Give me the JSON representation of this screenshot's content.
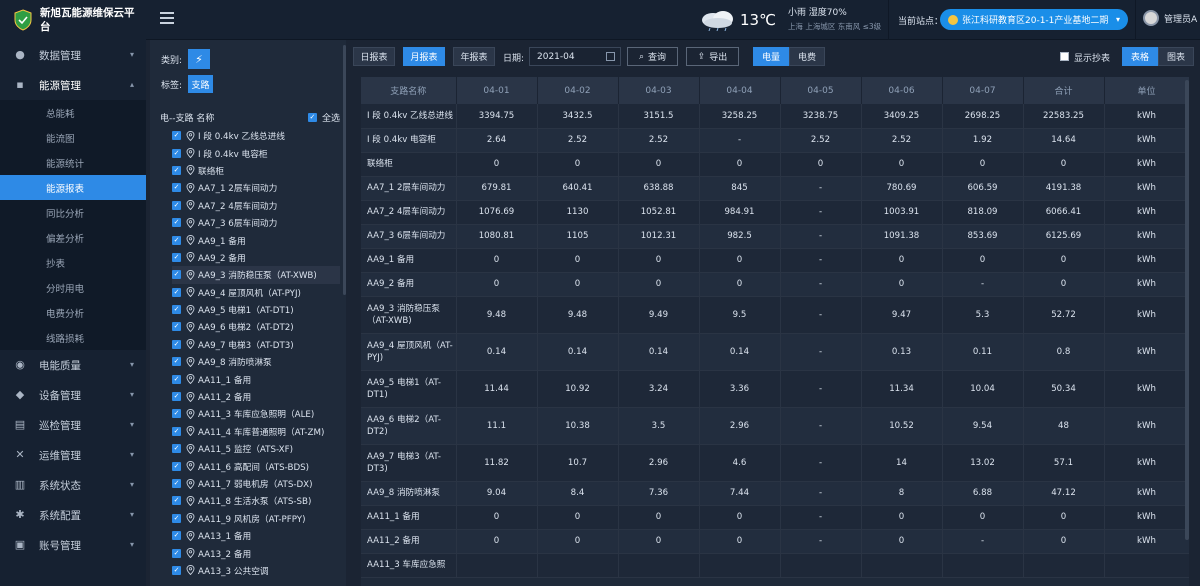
{
  "app": {
    "title": "新旭瓦能源维保云平台"
  },
  "header": {
    "weather": {
      "temp": "13℃",
      "line1": "小雨  湿度70%",
      "line2": "上海  上海城区 东南风 ≤3级"
    },
    "site_label": "当前站点：",
    "site_value": "张江科研教育区20-1-1产业基地二期",
    "user_name": "管理员A"
  },
  "sidebar": {
    "items": [
      {
        "label": "数据管理",
        "icon": "users-icon"
      },
      {
        "label": "能源管理",
        "icon": "hierarchy-icon"
      },
      {
        "label": "电能质量",
        "icon": "gauge-icon"
      },
      {
        "label": "设备管理",
        "icon": "cube-icon"
      },
      {
        "label": "巡检管理",
        "icon": "chart-icon"
      },
      {
        "label": "运维管理",
        "icon": "tools-icon"
      },
      {
        "label": "系统状态",
        "icon": "bar-chart-icon"
      },
      {
        "label": "系统配置",
        "icon": "gear-icon"
      },
      {
        "label": "账号管理",
        "icon": "account-icon"
      }
    ],
    "sub_items": [
      "总能耗",
      "能流图",
      "能源统计",
      "能源报表",
      "同比分析",
      "偏差分析",
      "抄表",
      "分时用电",
      "电费分析",
      "线路损耗"
    ]
  },
  "tree": {
    "type_label": "类别:",
    "tag_label": "标签:",
    "tag_value": "支路",
    "head_label": "电--支路 名称",
    "select_all": "全选",
    "items": [
      "I 段 0.4kv 乙线总进线",
      "I 段 0.4kv 电容柜",
      "联络柜",
      "AA7_1 2层车间动力",
      "AA7_2 4层车间动力",
      "AA7_3 6层车间动力",
      "AA9_1 备用",
      "AA9_2 备用",
      "AA9_3 消防稳压泵（AT-XWB)",
      "AA9_4 屋顶风机（AT-PYJ)",
      "AA9_5 电梯1（AT-DT1)",
      "AA9_6 电梯2（AT-DT2)",
      "AA9_7 电梯3（AT-DT3)",
      "AA9_8 消防喷淋泵",
      "AA11_1 备用",
      "AA11_2 备用",
      "AA11_3 车库应急照明（ALE)",
      "AA11_4 车库普通照明（AT-ZM)",
      "AA11_5 监控（ATS-XF)",
      "AA11_6 高配间（ATS-BDS)",
      "AA11_7 弱电机房（ATS-DX)",
      "AA11_8 生活水泵（ATS-SB)",
      "AA11_9 风机房（AT-PFPY)",
      "AA13_1 备用",
      "AA13_2 备用",
      "AA13_3 公共空调"
    ]
  },
  "toolbar": {
    "day": "日报表",
    "month": "月报表",
    "year": "年报表",
    "date_label": "日期:",
    "date_value": "2021-04",
    "query": "查询",
    "export": "导出",
    "power": "电量",
    "fee": "电费",
    "show_reading": "显示抄表",
    "table_view": "表格",
    "chart_view": "图表"
  },
  "table": {
    "headers": [
      "支路名称",
      "04-01",
      "04-02",
      "04-03",
      "04-04",
      "04-05",
      "04-06",
      "04-07",
      "合计",
      "单位"
    ],
    "rows": [
      [
        "I 段 0.4kv 乙线总进线",
        "3394.75",
        "3432.5",
        "3151.5",
        "3258.25",
        "3238.75",
        "3409.25",
        "2698.25",
        "22583.25",
        "kWh"
      ],
      [
        "I 段 0.4kv 电容柜",
        "2.64",
        "2.52",
        "2.52",
        "-",
        "2.52",
        "2.52",
        "1.92",
        "14.64",
        "kWh"
      ],
      [
        "联络柜",
        "0",
        "0",
        "0",
        "0",
        "0",
        "0",
        "0",
        "0",
        "kWh"
      ],
      [
        "AA7_1 2层车间动力",
        "679.81",
        "640.41",
        "638.88",
        "845",
        "-",
        "780.69",
        "606.59",
        "4191.38",
        "kWh"
      ],
      [
        "AA7_2 4层车间动力",
        "1076.69",
        "1130",
        "1052.81",
        "984.91",
        "-",
        "1003.91",
        "818.09",
        "6066.41",
        "kWh"
      ],
      [
        "AA7_3 6层车间动力",
        "1080.81",
        "1105",
        "1012.31",
        "982.5",
        "-",
        "1091.38",
        "853.69",
        "6125.69",
        "kWh"
      ],
      [
        "AA9_1 备用",
        "0",
        "0",
        "0",
        "0",
        "-",
        "0",
        "0",
        "0",
        "kWh"
      ],
      [
        "AA9_2 备用",
        "0",
        "0",
        "0",
        "0",
        "-",
        "0",
        "-",
        "0",
        "kWh"
      ],
      [
        "AA9_3 消防稳压泵（AT-XWB)",
        "9.48",
        "9.48",
        "9.49",
        "9.5",
        "-",
        "9.47",
        "5.3",
        "52.72",
        "kWh"
      ],
      [
        "AA9_4 屋顶风机（AT-PYJ)",
        "0.14",
        "0.14",
        "0.14",
        "0.14",
        "-",
        "0.13",
        "0.11",
        "0.8",
        "kWh"
      ],
      [
        "AA9_5 电梯1（AT-DT1)",
        "11.44",
        "10.92",
        "3.24",
        "3.36",
        "-",
        "11.34",
        "10.04",
        "50.34",
        "kWh"
      ],
      [
        "AA9_6 电梯2（AT-DT2)",
        "11.1",
        "10.38",
        "3.5",
        "2.96",
        "-",
        "10.52",
        "9.54",
        "48",
        "kWh"
      ],
      [
        "AA9_7 电梯3（AT-DT3)",
        "11.82",
        "10.7",
        "2.96",
        "4.6",
        "-",
        "14",
        "13.02",
        "57.1",
        "kWh"
      ],
      [
        "AA9_8 消防喷淋泵",
        "9.04",
        "8.4",
        "7.36",
        "7.44",
        "-",
        "8",
        "6.88",
        "47.12",
        "kWh"
      ],
      [
        "AA11_1 备用",
        "0",
        "0",
        "0",
        "0",
        "-",
        "0",
        "0",
        "0",
        "kWh"
      ],
      [
        "AA11_2 备用",
        "0",
        "0",
        "0",
        "0",
        "-",
        "0",
        "-",
        "0",
        "kWh"
      ],
      [
        "AA11_3 车库应急照",
        "",
        "",
        "",
        "",
        "",
        "",
        "",
        "",
        ""
      ]
    ]
  },
  "colors": {
    "accent": "#2e8ae6",
    "sidebar_bg": "#162131",
    "main_bg": "#1b2433"
  }
}
